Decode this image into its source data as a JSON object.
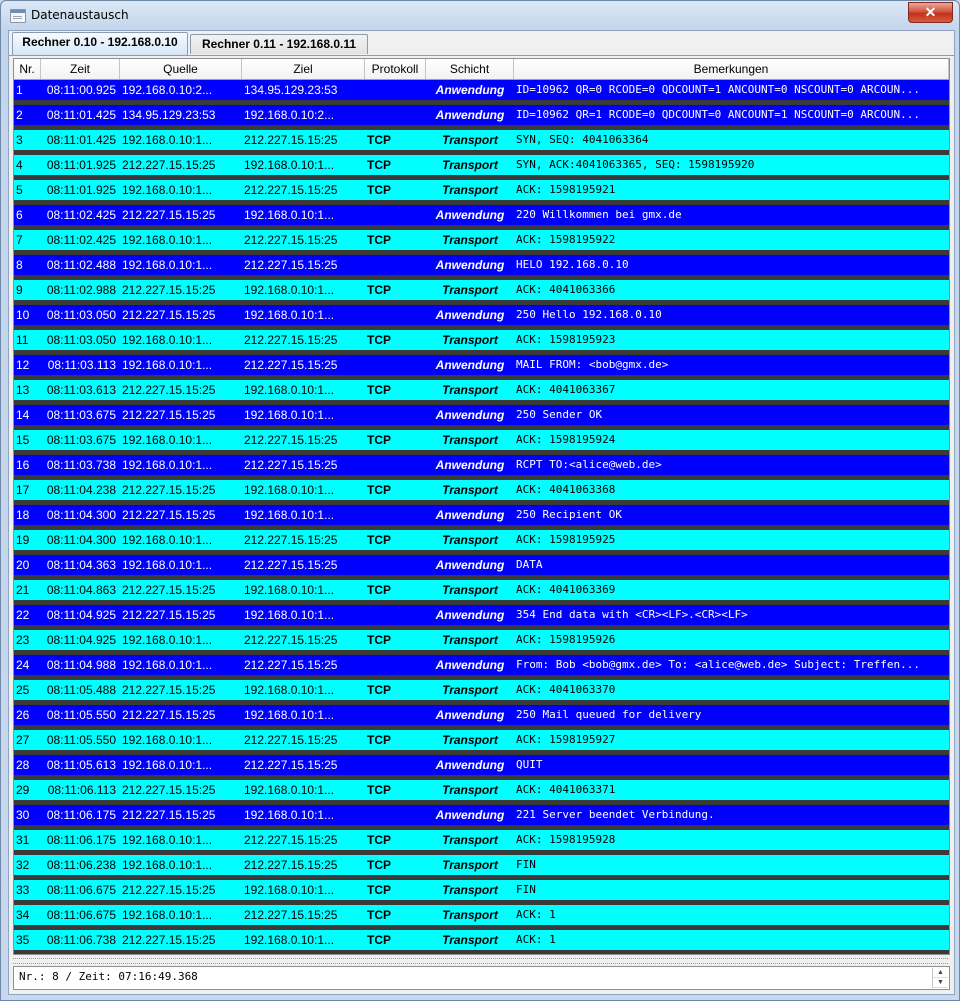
{
  "window": {
    "title": "Datenaustausch",
    "close_label": "✕"
  },
  "tabs": [
    {
      "label": "Rechner 0.10 - 192.168.0.10",
      "active": true
    },
    {
      "label": "Rechner 0.11 - 192.168.0.11",
      "active": false
    }
  ],
  "columns": [
    "Nr.",
    "Zeit",
    "Quelle",
    "Ziel",
    "Protokoll",
    "Schicht",
    "Bemerkungen"
  ],
  "colors": {
    "anwendung_row": "#0000ff",
    "transport_row": "#00ffff",
    "separator": "#3a3a3a"
  },
  "rows": [
    {
      "nr": "1",
      "zeit": "08:11:00.925",
      "quelle": "192.168.0.10:2...",
      "ziel": "134.95.129.23:53",
      "protokoll": "",
      "schicht": "Anwendung",
      "bemerkung": "ID=10962 QR=0 RCODE=0 QDCOUNT=1 ANCOUNT=0 NSCOUNT=0 ARCOUN..."
    },
    {
      "nr": "2",
      "zeit": "08:11:01.425",
      "quelle": "134.95.129.23:53",
      "ziel": "192.168.0.10:2...",
      "protokoll": "",
      "schicht": "Anwendung",
      "bemerkung": "ID=10962 QR=1 RCODE=0 QDCOUNT=0 ANCOUNT=1 NSCOUNT=0 ARCOUN..."
    },
    {
      "nr": "3",
      "zeit": "08:11:01.425",
      "quelle": "192.168.0.10:1...",
      "ziel": "212.227.15.15:25",
      "protokoll": "TCP",
      "schicht": "Transport",
      "bemerkung": "SYN, SEQ: 4041063364"
    },
    {
      "nr": "4",
      "zeit": "08:11:01.925",
      "quelle": "212.227.15.15:25",
      "ziel": "192.168.0.10:1...",
      "protokoll": "TCP",
      "schicht": "Transport",
      "bemerkung": "SYN, ACK:4041063365, SEQ: 1598195920"
    },
    {
      "nr": "5",
      "zeit": "08:11:01.925",
      "quelle": "192.168.0.10:1...",
      "ziel": "212.227.15.15:25",
      "protokoll": "TCP",
      "schicht": "Transport",
      "bemerkung": "ACK: 1598195921"
    },
    {
      "nr": "6",
      "zeit": "08:11:02.425",
      "quelle": "212.227.15.15:25",
      "ziel": "192.168.0.10:1...",
      "protokoll": "",
      "schicht": "Anwendung",
      "bemerkung": "220 Willkommen bei gmx.de"
    },
    {
      "nr": "7",
      "zeit": "08:11:02.425",
      "quelle": "192.168.0.10:1...",
      "ziel": "212.227.15.15:25",
      "protokoll": "TCP",
      "schicht": "Transport",
      "bemerkung": "ACK: 1598195922"
    },
    {
      "nr": "8",
      "zeit": "08:11:02.488",
      "quelle": "192.168.0.10:1...",
      "ziel": "212.227.15.15:25",
      "protokoll": "",
      "schicht": "Anwendung",
      "bemerkung": "HELO 192.168.0.10"
    },
    {
      "nr": "9",
      "zeit": "08:11:02.988",
      "quelle": "212.227.15.15:25",
      "ziel": "192.168.0.10:1...",
      "protokoll": "TCP",
      "schicht": "Transport",
      "bemerkung": "ACK: 4041063366"
    },
    {
      "nr": "10",
      "zeit": "08:11:03.050",
      "quelle": "212.227.15.15:25",
      "ziel": "192.168.0.10:1...",
      "protokoll": "",
      "schicht": "Anwendung",
      "bemerkung": "250 Hello 192.168.0.10"
    },
    {
      "nr": "11",
      "zeit": "08:11:03.050",
      "quelle": "192.168.0.10:1...",
      "ziel": "212.227.15.15:25",
      "protokoll": "TCP",
      "schicht": "Transport",
      "bemerkung": "ACK: 1598195923"
    },
    {
      "nr": "12",
      "zeit": "08:11:03.113",
      "quelle": "192.168.0.10:1...",
      "ziel": "212.227.15.15:25",
      "protokoll": "",
      "schicht": "Anwendung",
      "bemerkung": "MAIL FROM: <bob@gmx.de>"
    },
    {
      "nr": "13",
      "zeit": "08:11:03.613",
      "quelle": "212.227.15.15:25",
      "ziel": "192.168.0.10:1...",
      "protokoll": "TCP",
      "schicht": "Transport",
      "bemerkung": "ACK: 4041063367"
    },
    {
      "nr": "14",
      "zeit": "08:11:03.675",
      "quelle": "212.227.15.15:25",
      "ziel": "192.168.0.10:1...",
      "protokoll": "",
      "schicht": "Anwendung",
      "bemerkung": "250 Sender OK"
    },
    {
      "nr": "15",
      "zeit": "08:11:03.675",
      "quelle": "192.168.0.10:1...",
      "ziel": "212.227.15.15:25",
      "protokoll": "TCP",
      "schicht": "Transport",
      "bemerkung": "ACK: 1598195924"
    },
    {
      "nr": "16",
      "zeit": "08:11:03.738",
      "quelle": "192.168.0.10:1...",
      "ziel": "212.227.15.15:25",
      "protokoll": "",
      "schicht": "Anwendung",
      "bemerkung": "RCPT TO:<alice@web.de>"
    },
    {
      "nr": "17",
      "zeit": "08:11:04.238",
      "quelle": "212.227.15.15:25",
      "ziel": "192.168.0.10:1...",
      "protokoll": "TCP",
      "schicht": "Transport",
      "bemerkung": "ACK: 4041063368"
    },
    {
      "nr": "18",
      "zeit": "08:11:04.300",
      "quelle": "212.227.15.15:25",
      "ziel": "192.168.0.10:1...",
      "protokoll": "",
      "schicht": "Anwendung",
      "bemerkung": "250 Recipient OK"
    },
    {
      "nr": "19",
      "zeit": "08:11:04.300",
      "quelle": "192.168.0.10:1...",
      "ziel": "212.227.15.15:25",
      "protokoll": "TCP",
      "schicht": "Transport",
      "bemerkung": "ACK: 1598195925"
    },
    {
      "nr": "20",
      "zeit": "08:11:04.363",
      "quelle": "192.168.0.10:1...",
      "ziel": "212.227.15.15:25",
      "protokoll": "",
      "schicht": "Anwendung",
      "bemerkung": "DATA"
    },
    {
      "nr": "21",
      "zeit": "08:11:04.863",
      "quelle": "212.227.15.15:25",
      "ziel": "192.168.0.10:1...",
      "protokoll": "TCP",
      "schicht": "Transport",
      "bemerkung": "ACK: 4041063369"
    },
    {
      "nr": "22",
      "zeit": "08:11:04.925",
      "quelle": "212.227.15.15:25",
      "ziel": "192.168.0.10:1...",
      "protokoll": "",
      "schicht": "Anwendung",
      "bemerkung": "354 End data with <CR><LF>.<CR><LF>"
    },
    {
      "nr": "23",
      "zeit": "08:11:04.925",
      "quelle": "192.168.0.10:1...",
      "ziel": "212.227.15.15:25",
      "protokoll": "TCP",
      "schicht": "Transport",
      "bemerkung": "ACK: 1598195926"
    },
    {
      "nr": "24",
      "zeit": "08:11:04.988",
      "quelle": "192.168.0.10:1...",
      "ziel": "212.227.15.15:25",
      "protokoll": "",
      "schicht": "Anwendung",
      "bemerkung": "From: Bob <bob@gmx.de> To: <alice@web.de> Subject: Treffen..."
    },
    {
      "nr": "25",
      "zeit": "08:11:05.488",
      "quelle": "212.227.15.15:25",
      "ziel": "192.168.0.10:1...",
      "protokoll": "TCP",
      "schicht": "Transport",
      "bemerkung": "ACK: 4041063370"
    },
    {
      "nr": "26",
      "zeit": "08:11:05.550",
      "quelle": "212.227.15.15:25",
      "ziel": "192.168.0.10:1...",
      "protokoll": "",
      "schicht": "Anwendung",
      "bemerkung": "250 Mail queued for delivery"
    },
    {
      "nr": "27",
      "zeit": "08:11:05.550",
      "quelle": "192.168.0.10:1...",
      "ziel": "212.227.15.15:25",
      "protokoll": "TCP",
      "schicht": "Transport",
      "bemerkung": "ACK: 1598195927"
    },
    {
      "nr": "28",
      "zeit": "08:11:05.613",
      "quelle": "192.168.0.10:1...",
      "ziel": "212.227.15.15:25",
      "protokoll": "",
      "schicht": "Anwendung",
      "bemerkung": "QUIT"
    },
    {
      "nr": "29",
      "zeit": "08:11:06.113",
      "quelle": "212.227.15.15:25",
      "ziel": "192.168.0.10:1...",
      "protokoll": "TCP",
      "schicht": "Transport",
      "bemerkung": "ACK: 4041063371"
    },
    {
      "nr": "30",
      "zeit": "08:11:06.175",
      "quelle": "212.227.15.15:25",
      "ziel": "192.168.0.10:1...",
      "protokoll": "",
      "schicht": "Anwendung",
      "bemerkung": "221 Server beendet Verbindung."
    },
    {
      "nr": "31",
      "zeit": "08:11:06.175",
      "quelle": "192.168.0.10:1...",
      "ziel": "212.227.15.15:25",
      "protokoll": "TCP",
      "schicht": "Transport",
      "bemerkung": "ACK: 1598195928"
    },
    {
      "nr": "32",
      "zeit": "08:11:06.238",
      "quelle": "192.168.0.10:1...",
      "ziel": "212.227.15.15:25",
      "protokoll": "TCP",
      "schicht": "Transport",
      "bemerkung": "FIN"
    },
    {
      "nr": "33",
      "zeit": "08:11:06.675",
      "quelle": "212.227.15.15:25",
      "ziel": "192.168.0.10:1...",
      "protokoll": "TCP",
      "schicht": "Transport",
      "bemerkung": "FIN"
    },
    {
      "nr": "34",
      "zeit": "08:11:06.675",
      "quelle": "192.168.0.10:1...",
      "ziel": "212.227.15.15:25",
      "protokoll": "TCP",
      "schicht": "Transport",
      "bemerkung": "ACK: 1"
    },
    {
      "nr": "35",
      "zeit": "08:11:06.738",
      "quelle": "212.227.15.15:25",
      "ziel": "192.168.0.10:1...",
      "protokoll": "TCP",
      "schicht": "Transport",
      "bemerkung": "ACK: 1"
    }
  ],
  "status": {
    "text": "Nr.: 8 / Zeit: 07:16:49.368",
    "spin_up_icon": "▲",
    "spin_down_icon": "▼"
  }
}
